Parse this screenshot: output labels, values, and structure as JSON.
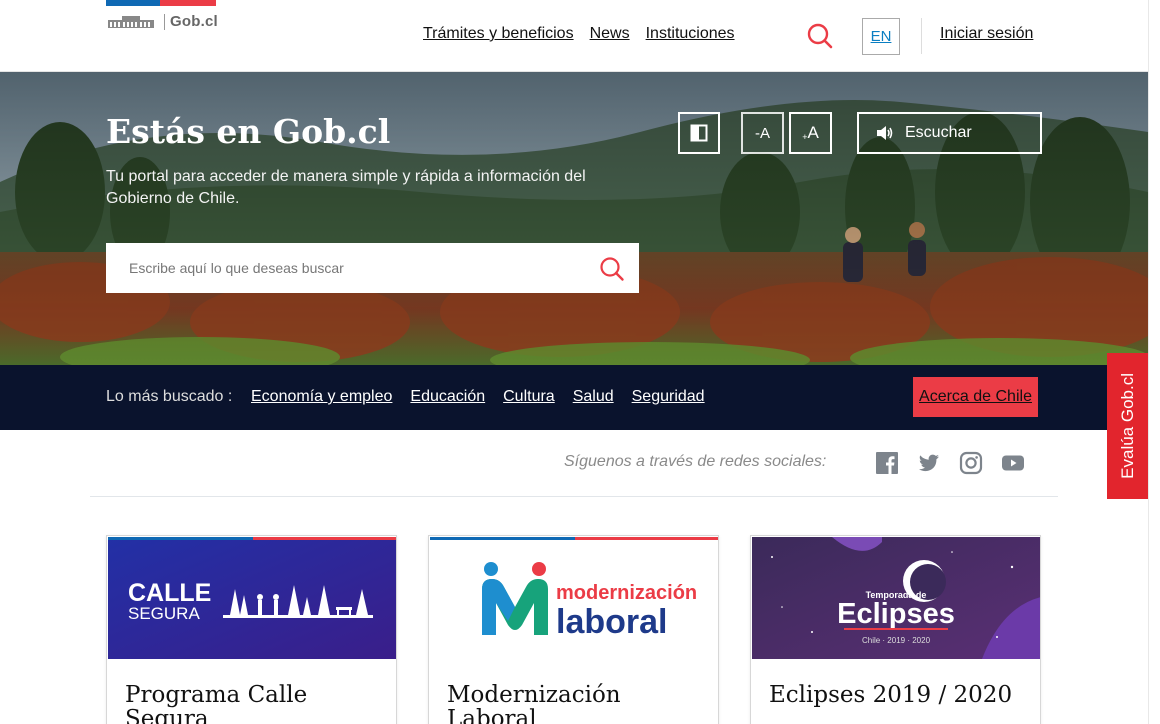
{
  "header": {
    "logo_text": "Gob.cl",
    "nav": [
      "Trámites y beneficios",
      "News",
      "Instituciones"
    ],
    "lang": "EN",
    "login": "Iniciar sesión"
  },
  "hero": {
    "title": "Estás en Gob.cl",
    "subtitle": "Tu portal para acceder de manera simple y rápida a información del Gobierno de Chile.",
    "search_placeholder": "Escribe aquí lo que deseas buscar",
    "tools": {
      "decrease": "A",
      "increase": "A",
      "listen": "Escuchar"
    }
  },
  "most_searched": {
    "label": "Lo más buscado :",
    "links": [
      "Economía y empleo",
      "Educación",
      "Cultura",
      "Salud",
      "Seguridad"
    ],
    "about_button": "Acerca de Chile"
  },
  "evaluate_tab": "Evalúa Gob.cl",
  "social": {
    "label": "Síguenos a través de redes sociales:",
    "icons": [
      "facebook-icon",
      "twitter-icon",
      "instagram-icon",
      "youtube-icon"
    ]
  },
  "cards": [
    {
      "title": "Programa Calle Segura",
      "image_text": [
        "CALLE",
        "SEGURA"
      ]
    },
    {
      "title": "Modernización Laboral",
      "image_text": [
        "modernización",
        "laboral"
      ]
    },
    {
      "title": "Eclipses 2019 / 2020",
      "image_text": [
        "Temporada de",
        "Eclipses",
        "Chile · 2019 · 2020"
      ]
    }
  ],
  "colors": {
    "brand_blue": "#0f69b4",
    "brand_red": "#eb3c46",
    "navy": "#0a132d",
    "search_icon": "#eb3c46"
  }
}
